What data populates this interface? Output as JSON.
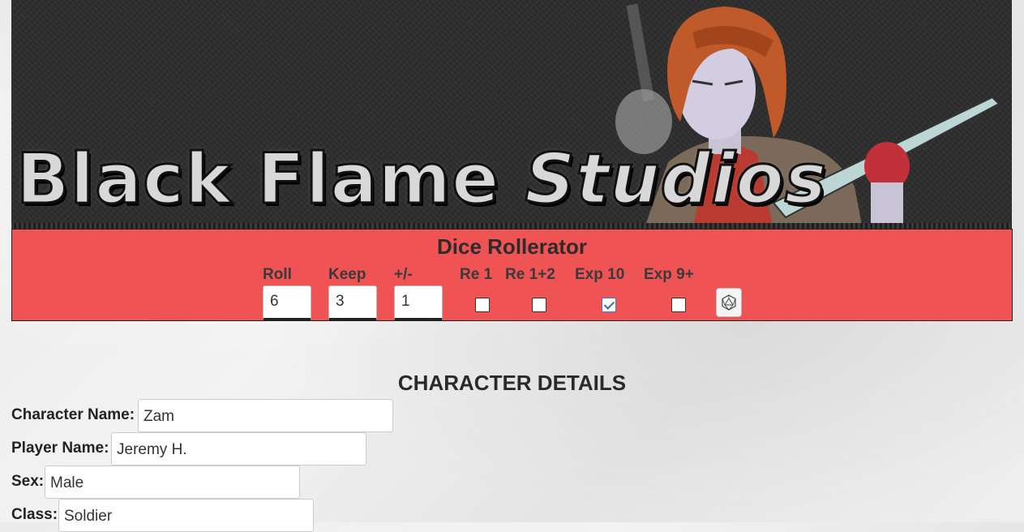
{
  "banner": {
    "title_part1": "Black Flame",
    "title_part2": "Studios"
  },
  "dice": {
    "title": "Dice Rollerator",
    "roll_label": "Roll",
    "keep_label": "Keep",
    "mod_label": "+/-",
    "re1_label": "Re 1",
    "re12_label": "Re 1+2",
    "exp10_label": "Exp 10",
    "exp9_label": "Exp 9+",
    "roll_value": "6",
    "keep_value": "3",
    "mod_value": "1",
    "re1_checked": false,
    "re12_checked": false,
    "exp10_checked": true,
    "exp9_checked": false,
    "roll_button_icon": "d20-dice-icon"
  },
  "character": {
    "section_title": "CHARACTER DETAILS",
    "fields": [
      {
        "label": "Character Name:",
        "value": "Zam"
      },
      {
        "label": "Player Name:",
        "value": "Jeremy H."
      },
      {
        "label": "Sex:",
        "value": "Male"
      },
      {
        "label": "Class:",
        "value": "Soldier"
      }
    ]
  },
  "colors": {
    "dice_panel": "#ef5354",
    "banner_bg": "#2b2b2b",
    "page_bg": "#ececec"
  }
}
